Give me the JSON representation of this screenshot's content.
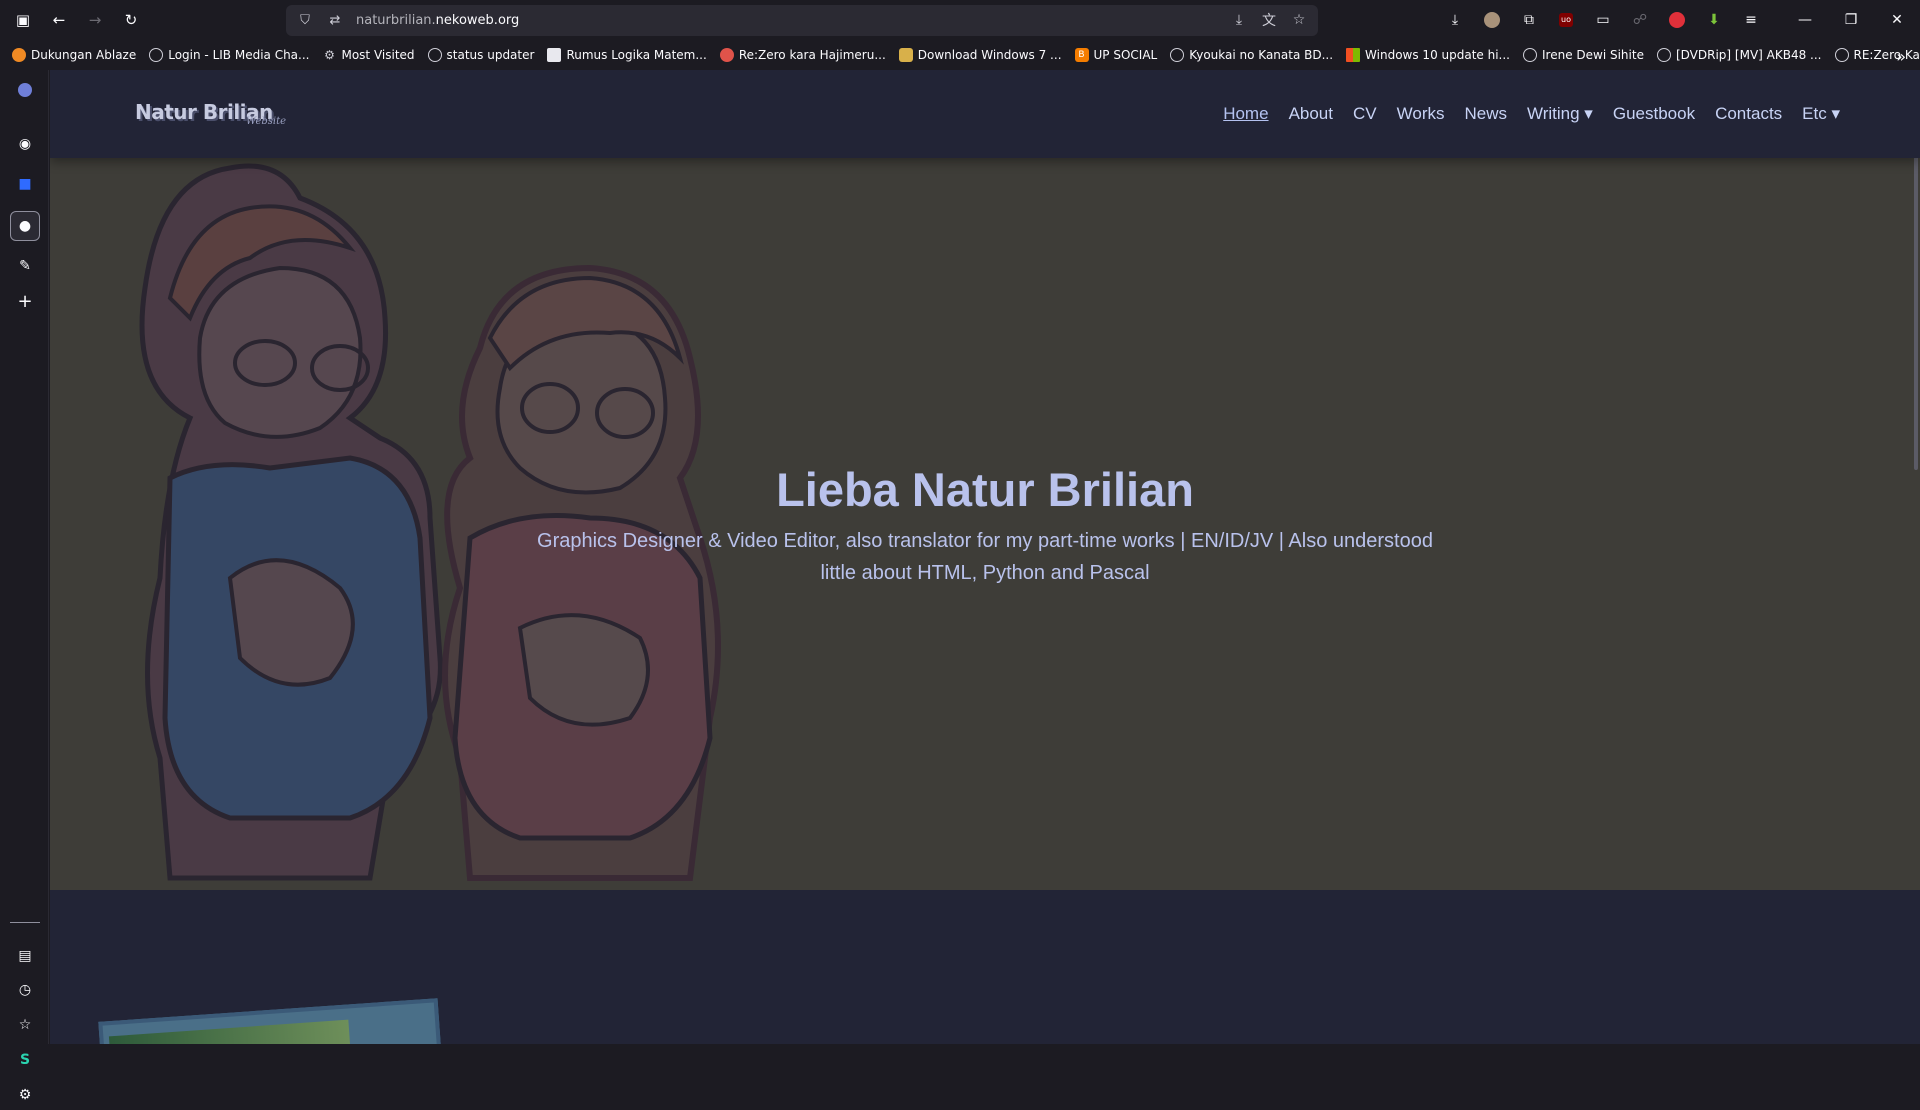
{
  "browser": {
    "url_prefix": "naturbrilian.",
    "url_domain": "nekoweb.org"
  },
  "bookmarks": [
    {
      "label": "Dukungan Ablaze",
      "icon": "flame-icon",
      "color": "#f08a24"
    },
    {
      "label": "Login - LIB Media Cha...",
      "icon": "globe-icon",
      "color": "#cfcfd8"
    },
    {
      "label": "Most Visited",
      "icon": "gear-icon",
      "color": "#cfcfd8"
    },
    {
      "label": "status updater",
      "icon": "globe-icon",
      "color": "#cfcfd8"
    },
    {
      "label": "Rumus Logika Matem...",
      "icon": "page-icon",
      "color": "#cfcfd8"
    },
    {
      "label": "Re:Zero kara Hajimeru...",
      "icon": "rezero-icon",
      "color": "#e0534a"
    },
    {
      "label": "Download Windows 7 ...",
      "icon": "shield-icon",
      "color": "#d8b04a"
    },
    {
      "label": "UP SOCIAL",
      "icon": "blogger-icon",
      "color": "#f57d00"
    },
    {
      "label": "Kyoukai no Kanata BD...",
      "icon": "globe-icon",
      "color": "#cfcfd8"
    },
    {
      "label": "Windows 10 update hi...",
      "icon": "windows-icon",
      "color": "#00a4ef"
    },
    {
      "label": "Irene Dewi Sihite",
      "icon": "globe-icon",
      "color": "#cfcfd8"
    },
    {
      "label": "[DVDRip] [MV] AKB48 ...",
      "icon": "globe-icon",
      "color": "#cfcfd8"
    },
    {
      "label": "RE:Zero Kara Hajimeru...",
      "icon": "globe-icon",
      "color": "#cfcfd8"
    }
  ],
  "site": {
    "logo": "Natur Brilian",
    "logo_sub": "Website",
    "menu": [
      {
        "label": "Home",
        "current": true
      },
      {
        "label": "About"
      },
      {
        "label": "CV"
      },
      {
        "label": "Works"
      },
      {
        "label": "News"
      },
      {
        "label": "Writing ▾"
      },
      {
        "label": "Guestbook"
      },
      {
        "label": "Contacts"
      },
      {
        "label": "Etc ▾"
      }
    ],
    "hero_title": "Lieba Natur Brilian",
    "hero_subtitle": "Graphics Designer & Video Editor, also translator for my part-time works | EN/ID/JV | Also understood little about HTML, Python and Pascal"
  },
  "colors": {
    "accent": "#b9c2ec",
    "nav_bg": "#222436",
    "hero_bg": "#3e3d38"
  }
}
